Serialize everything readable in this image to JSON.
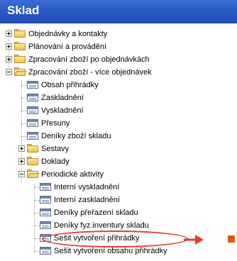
{
  "window": {
    "title": "Sklad"
  },
  "tree": {
    "items": [
      {
        "label": "Objednávky a kontakty",
        "expanded": false
      },
      {
        "label": "Plánování a provádění",
        "expanded": false
      },
      {
        "label": "Zpracování zboží po objednávkách",
        "expanded": false
      },
      {
        "label": "Zpracování zboží - více objednávek",
        "expanded": true,
        "children": [
          {
            "label": "Obsah přihrádky"
          },
          {
            "label": "Zaskladnění"
          },
          {
            "label": "Vyskladnění"
          },
          {
            "label": "Přesuny"
          },
          {
            "label": "Deníky zboží skladu"
          },
          {
            "label": "Sestavy",
            "expanded": false
          },
          {
            "label": "Doklady",
            "expanded": false
          },
          {
            "label": "Periodické aktivity",
            "expanded": true,
            "children": [
              {
                "label": "Interní vyskladnění"
              },
              {
                "label": "Interní zaskladnění"
              },
              {
                "label": "Deníky přeřazení skladu"
              },
              {
                "label": "Deníky fyz.inventury skladu"
              },
              {
                "label": "Sešit vytvoření přihrádky",
                "highlighted": true
              },
              {
                "label": "Sešit vytvoření obsahu přihrádky"
              }
            ]
          }
        ]
      }
    ]
  },
  "colors": {
    "title_bar": "#2a59c6",
    "highlight": "#e33b2b",
    "marker": "#e2561c"
  }
}
